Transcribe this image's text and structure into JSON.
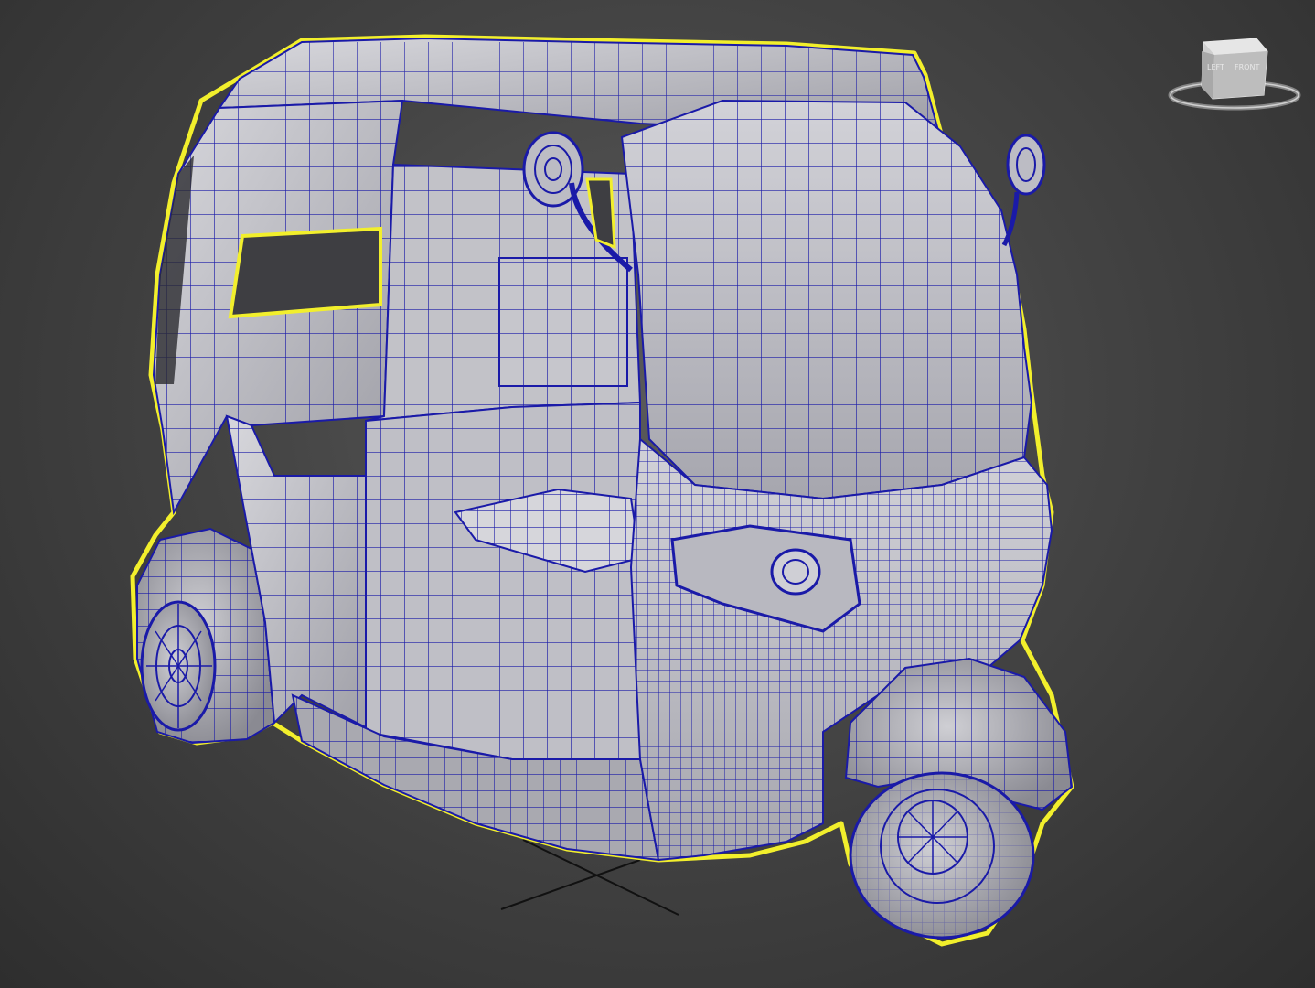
{
  "viewport": {
    "background_color": "#444444",
    "selection_outline_color": "#f2ef2c",
    "wireframe_color": "#1a1aa8",
    "surface_color": "#c9c9cf"
  },
  "viewcube": {
    "left_face_label": "LEFT",
    "front_face_label": "FRONT",
    "icon": "viewcube-icon"
  },
  "model": {
    "icon": "auto-rickshaw-mesh"
  }
}
